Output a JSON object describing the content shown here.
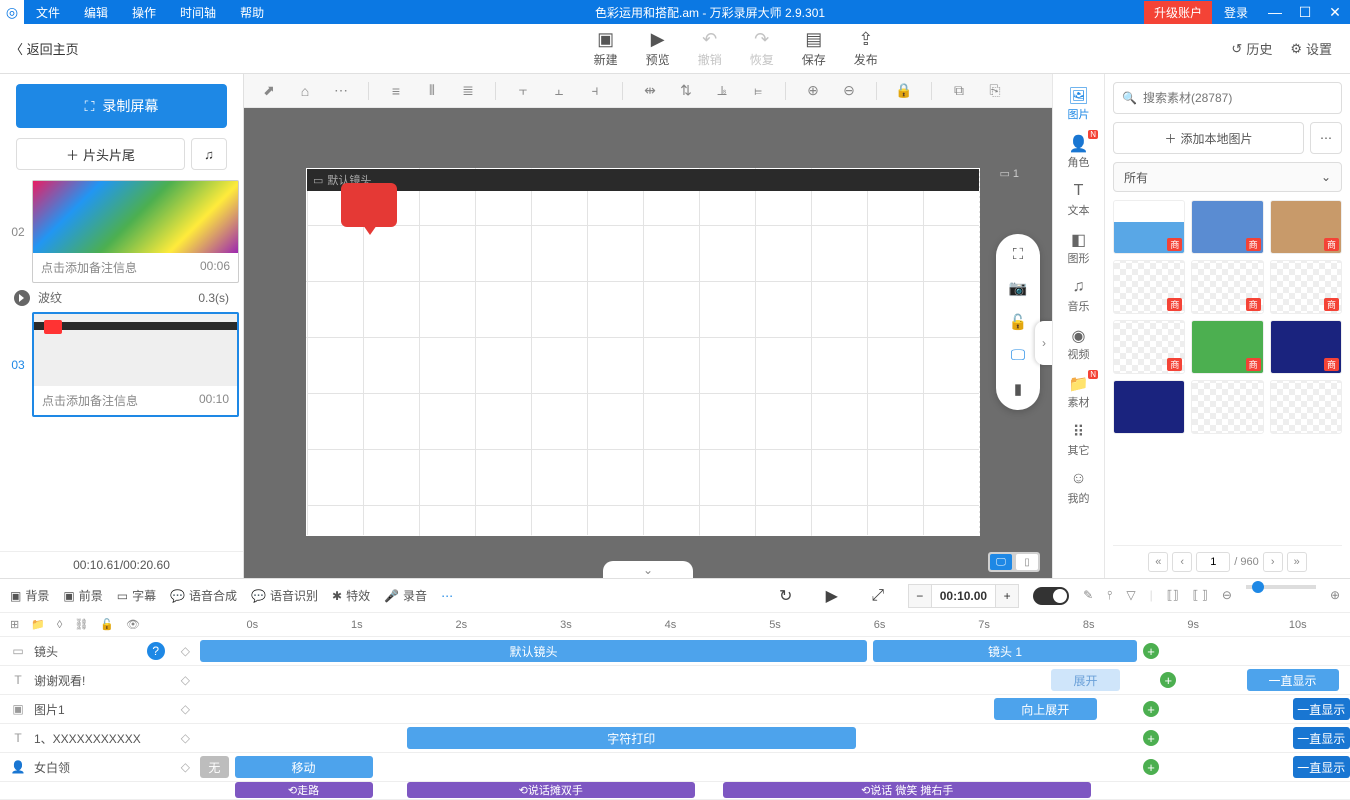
{
  "menubar": {
    "items": [
      "文件",
      "编辑",
      "操作",
      "时间轴",
      "帮助"
    ],
    "title": "色彩运用和搭配.am - 万彩录屏大师 2.9.301",
    "upgrade": "升级账户",
    "login": "登录"
  },
  "toolbar": {
    "back": "返回主页",
    "buttons": [
      {
        "label": "新建",
        "icon": "＋"
      },
      {
        "label": "预览",
        "icon": "▶"
      },
      {
        "label": "撤销",
        "icon": "↶",
        "disabled": true
      },
      {
        "label": "恢复",
        "icon": "↷",
        "disabled": true
      },
      {
        "label": "保存",
        "icon": "💾"
      },
      {
        "label": "发布",
        "icon": "⇪"
      }
    ],
    "history": "历史",
    "settings": "设置"
  },
  "left": {
    "record": "录制屏幕",
    "head_tail": "片头片尾",
    "thumbs": [
      {
        "idx": "02",
        "note": "点击添加备注信息",
        "dur": "00:06",
        "style": "colorful"
      },
      {
        "idx": "03",
        "note": "点击添加备注信息",
        "dur": "00:10",
        "style": "red",
        "selected": true
      }
    ],
    "transition": {
      "name": "波纹",
      "dur": "0.3(s)"
    },
    "time": "00:10.61/00:20.60"
  },
  "stage": {
    "shot_label": "默认镜头",
    "cam_index": "1"
  },
  "cat_rail": [
    {
      "label": "图片",
      "icon": "🖼",
      "active": true
    },
    {
      "label": "角色",
      "icon": "👤",
      "badge": "N"
    },
    {
      "label": "文本",
      "icon": "T"
    },
    {
      "label": "图形",
      "icon": "◧"
    },
    {
      "label": "音乐",
      "icon": "♫"
    },
    {
      "label": "视频",
      "icon": "◉"
    },
    {
      "label": "素材",
      "icon": "📁",
      "badge": "N"
    },
    {
      "label": "其它",
      "icon": "⠿"
    },
    {
      "label": "我的",
      "icon": "☺"
    }
  ],
  "assets": {
    "search_placeholder": "搜索素材(28787)",
    "add_local": "添加本地图片",
    "filter": "所有",
    "tag": "商",
    "page": "1",
    "total": "/ 960"
  },
  "bottom": {
    "tools": [
      "背景",
      "前景",
      "字幕",
      "语音合成",
      "语音识别",
      "特效",
      "录音"
    ],
    "time": "00:10.00",
    "ruler": [
      "0s",
      "1s",
      "2s",
      "3s",
      "4s",
      "5s",
      "6s",
      "7s",
      "8s",
      "9s",
      "10s"
    ],
    "tracks": {
      "shot": {
        "label": "镜头",
        "clips": [
          {
            "label": "默认镜头"
          },
          {
            "label": "镜头 1"
          }
        ]
      },
      "t1": {
        "label": "谢谢观看!",
        "expand": "展开",
        "always": "一直显示"
      },
      "img": {
        "label": "图片1",
        "expand": "向上展开",
        "always": "一直显示"
      },
      "t2": {
        "label": "1、XXXXXXXXXXX",
        "print": "字符打印",
        "always": "一直显示"
      },
      "actor": {
        "label": "女白领",
        "none": "无",
        "move": "移动",
        "walk": "走路",
        "talk1": "说话摊双手",
        "talk2": "说话 微笑 摊右手",
        "always": "一直显示"
      }
    }
  }
}
